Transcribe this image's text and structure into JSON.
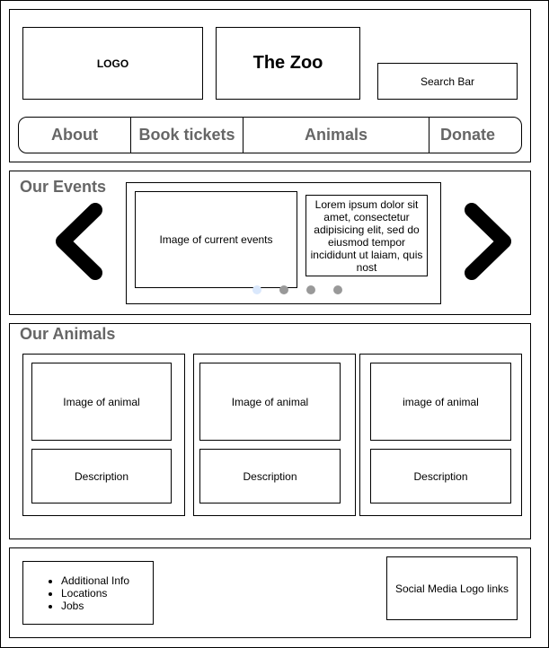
{
  "header": {
    "logo": "LOGO",
    "site_title": "The Zoo",
    "search_placeholder": "Search Bar"
  },
  "nav": {
    "items": [
      "About",
      "Book tickets",
      "Animals",
      "Donate"
    ]
  },
  "events": {
    "title": "Our Events",
    "image_label": "Image of current events",
    "text": "Lorem ipsum dolor sit amet, consectetur adipisicing elit, sed do eiusmod tempor incididunt ut laiam, quis nost",
    "slide_count": 4,
    "active_slide": 1
  },
  "animals": {
    "title": "Our Animals",
    "cards": [
      {
        "image": "Image of animal",
        "description": "Description"
      },
      {
        "image": "Image of animal",
        "description": "Description"
      },
      {
        "image": "image of animal",
        "description": "Description"
      }
    ]
  },
  "footer": {
    "links": [
      "Additional Info",
      "Locations",
      "Jobs"
    ],
    "social": "Social Media Logo links"
  }
}
